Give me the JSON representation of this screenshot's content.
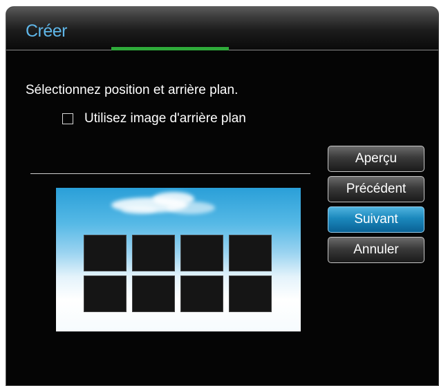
{
  "dialog": {
    "title": "Créer",
    "instruction": "Sélectionnez position et arrière plan.",
    "background_checkbox": {
      "label": "Utilisez image d'arrière plan",
      "checked": false
    },
    "preview": {
      "tile_rows": 2,
      "tile_columns": 4
    },
    "buttons": {
      "preview": "Aperçu",
      "previous": "Précédent",
      "next": "Suivant",
      "cancel": "Annuler"
    },
    "focused_button": "next"
  },
  "colors": {
    "title": "#5fb6e8",
    "accent": "#2faa3a",
    "focus": "#1b88bd"
  }
}
